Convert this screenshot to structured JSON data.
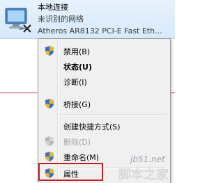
{
  "connection": {
    "title": "本地连接",
    "status": "未识别的网络",
    "adapter": "Atheros AR8132 PCI-E Fast Eth..."
  },
  "menu": {
    "items": [
      {
        "label": "禁用(B)",
        "shield": true,
        "bold": false,
        "disabled": false
      },
      {
        "label": "状态(U)",
        "shield": false,
        "bold": true,
        "disabled": false
      },
      {
        "label": "诊断(I)",
        "shield": false,
        "bold": false,
        "disabled": false
      },
      {
        "label": "桥接(G)",
        "shield": true,
        "bold": false,
        "disabled": false
      },
      {
        "label": "创建快捷方式(S)",
        "shield": false,
        "bold": false,
        "disabled": false
      },
      {
        "label": "删除(D)",
        "shield": true,
        "bold": false,
        "disabled": true
      },
      {
        "label": "重命名(M)",
        "shield": true,
        "bold": false,
        "disabled": false
      },
      {
        "label": "属性",
        "shield": true,
        "bold": false,
        "disabled": false
      }
    ]
  },
  "watermark": {
    "site": "jb51.net",
    "name": "脚本之家"
  },
  "colors": {
    "highlight": "#c81f26",
    "menu_bg": "#f0f0f0",
    "panel_bg": "#dcecfc"
  }
}
